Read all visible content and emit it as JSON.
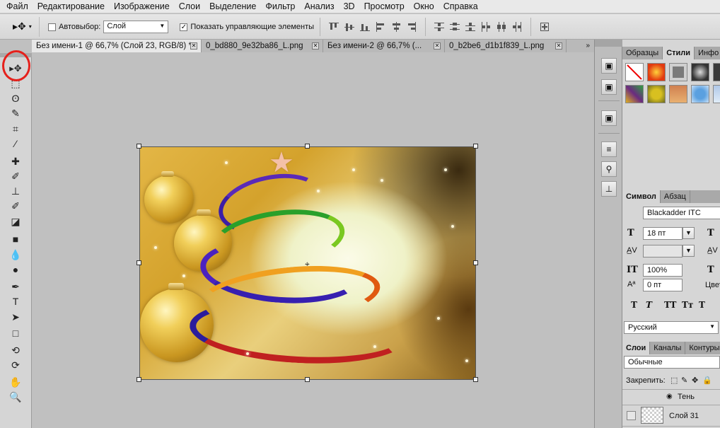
{
  "menu": {
    "items": [
      "Файл",
      "Редактирование",
      "Изображение",
      "Слои",
      "Выделение",
      "Фильтр",
      "Анализ",
      "3D",
      "Просмотр",
      "Окно",
      "Справка"
    ]
  },
  "options": {
    "tool_icon": "move-tool-icon",
    "auto_select_label": "Автовыбор:",
    "auto_select_checked": false,
    "auto_select_value": "Слой",
    "show_controls_label": "Показать управляющие элементы",
    "show_controls_checked": true,
    "check_mark": "✓"
  },
  "tabs": [
    {
      "label": "Без имени-1 @ 66,7% (Слой 23, RGB/8) *",
      "active": true
    },
    {
      "label": "0_bd880_9e32ba86_L.png",
      "active": false
    },
    {
      "label": "Без имени-2 @ 66,7% (...",
      "active": false
    },
    {
      "label": "0_b2be6_d1b1f839_L.png",
      "active": false
    }
  ],
  "tab_close": "✕",
  "toolbox": {
    "tools": [
      "move-tool",
      "marquee-tool",
      "lasso-tool",
      "quick-selection-tool",
      "crop-tool",
      "eyedropper-tool",
      "healing-brush-tool",
      "brush-tool",
      "clone-stamp-tool",
      "history-brush-tool",
      "eraser-tool",
      "gradient-tool",
      "blur-tool",
      "dodge-tool",
      "pen-tool",
      "type-tool",
      "path-selection-tool",
      "rectangle-tool",
      "3d-rotate-tool",
      "3d-orbit-tool",
      "hand-tool",
      "zoom-tool"
    ],
    "glyphs": [
      "▸✥",
      "⬚",
      "ʘ",
      "✎",
      "⌗",
      "⁄",
      "✚",
      "✐",
      "⊥",
      "✐",
      "◪",
      "■",
      "💧",
      "●",
      "✒",
      "T",
      "➤",
      "□",
      "⟲",
      "⟳",
      "✋",
      "🔍"
    ],
    "highlighted_tool": "move-tool"
  },
  "styles_panel": {
    "tabs": [
      "Образцы",
      "Стили",
      "Инфо"
    ],
    "active_tab": "Стили",
    "swatch_colors": [
      "#ffffff",
      "#e23a10",
      "#6a6a6a",
      "#333333",
      "#3a3a3a",
      "#6a2a80",
      "#d8c020",
      "#d08050",
      "#5aa0e0",
      "#b0c8e8"
    ]
  },
  "character_panel": {
    "tabs": [
      "Символ",
      "Абзац"
    ],
    "active_tab": "Символ",
    "font_family": "Blackadder ITC",
    "font_size": "18 пт",
    "kerning": "",
    "vertical_scale": "100%",
    "baseline_shift": "0 пт",
    "color_label": "Цвет",
    "style_buttons": [
      "T",
      "T",
      "TT",
      "Tт",
      "T"
    ],
    "language": "Русский"
  },
  "layers_panel": {
    "tabs": [
      "Слои",
      "Каналы",
      "Контуры"
    ],
    "active_tab": "Слои",
    "blend_mode": "Обычные",
    "lock_label": "Закрепить:",
    "effect_label": "Тень",
    "layer_name": "Слой 31"
  },
  "colors": {
    "menu_bg": "#e9e9e9",
    "workspace_bg": "#c0c0c0",
    "highlight_ring": "#e5201b"
  }
}
